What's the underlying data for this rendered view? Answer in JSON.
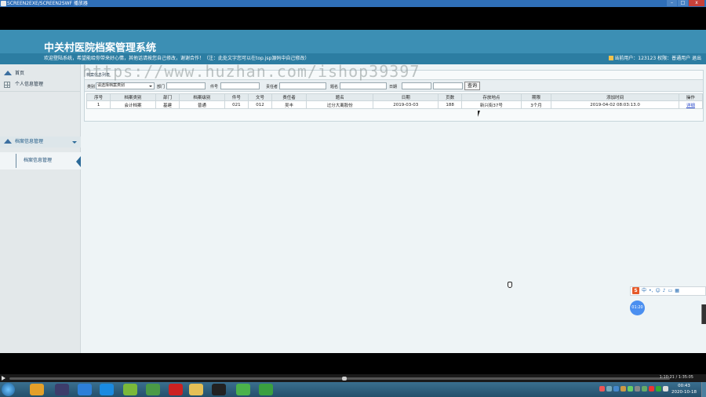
{
  "window": {
    "title": "SCREEN2EXE/SCREEN2SWF 播放器",
    "controls": [
      "–",
      "□",
      "x"
    ]
  },
  "app": {
    "title": "中关村医院档案管理系统",
    "notice": "欢迎登陆系统，希望能给你带来好心情，其他话请按您自己修改，谢谢合作！（注：此处文字您可以在top.jsp源码中自己修改）",
    "user_info": "当前用户：123123 权限：普通用户 退出"
  },
  "sidebar": {
    "home": "首页",
    "system": "个人信息管理",
    "archive_group": "档案信息管理",
    "archive_sub": "档案信息管理"
  },
  "panel": {
    "title": "档案信息列表",
    "filters": {
      "type_label": "类别",
      "type_value": "请选择档案类别",
      "dept_label": "部门",
      "book_label": "件号",
      "responsible_label": "责任者",
      "subject_label": "题名",
      "date_label": "日期",
      "query_button": "查询"
    }
  },
  "table": {
    "headers": [
      "序号",
      "档案类别",
      "部门",
      "档案级别",
      "件号",
      "文号",
      "责任者",
      "题名",
      "日期",
      "页数",
      "存放地点",
      "期限",
      "添加时间",
      "操作"
    ],
    "rows": [
      [
        "1",
        "会计档案",
        "基建",
        "普通",
        "021",
        "012",
        "吴丰",
        "过分大离股份",
        "2019-03-03",
        "188",
        "新兴街37号",
        "3个月",
        "2019-04-02 08:03:13.0",
        "详细"
      ]
    ]
  },
  "overlay": {
    "watermark": "https://www.huzhan.com/ishop39397",
    "timer": "01:20",
    "ime_label": "中"
  },
  "player": {
    "time": "1:10:21 / 1:35:05"
  },
  "taskbar": {
    "time": "00:43",
    "date": "2020-10-18"
  }
}
